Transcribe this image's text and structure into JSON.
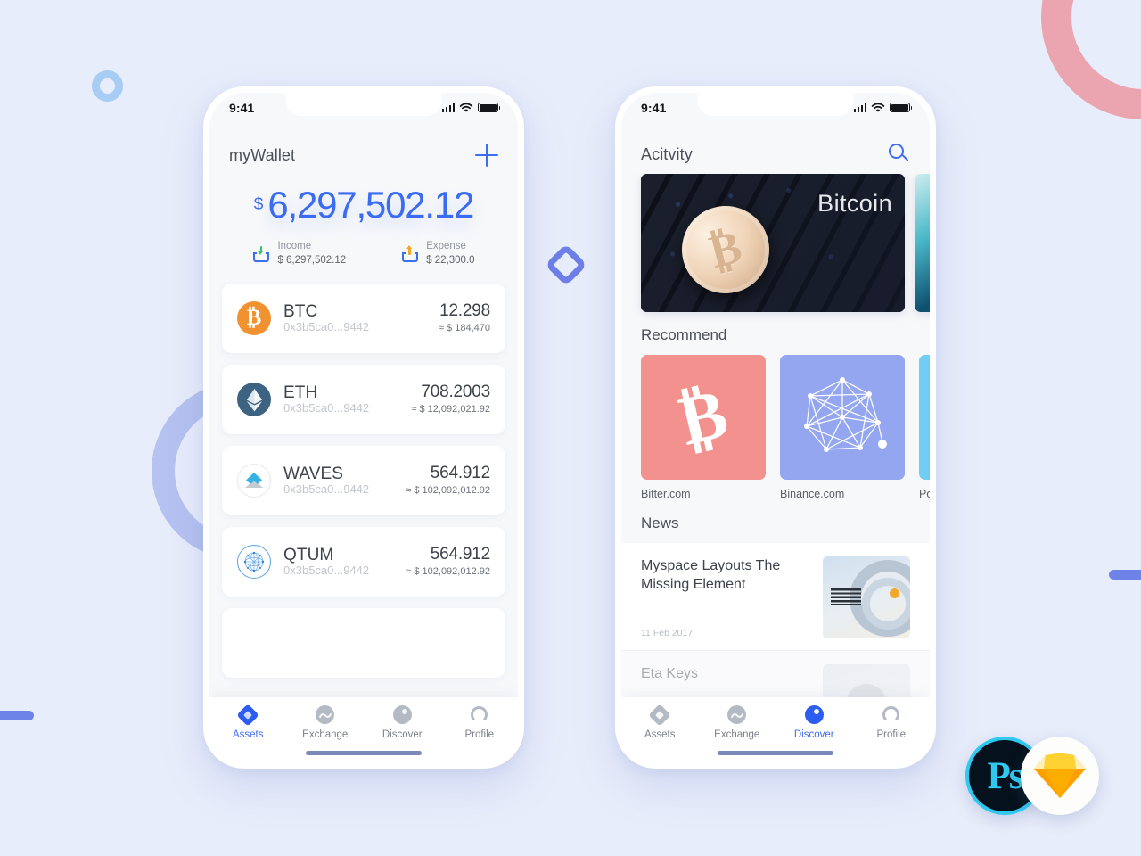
{
  "background": {
    "color": "#e8edfb",
    "decorations": [
      {
        "name": "pink-ring",
        "color": "#eaa5b0"
      },
      {
        "name": "periwinkle-ring",
        "color": "#b6c2f0"
      },
      {
        "name": "skyblue-ring",
        "color": "#a8cdf5"
      },
      {
        "name": "blue-bar-left",
        "color": "#6e83e8"
      },
      {
        "name": "blue-bar-right",
        "color": "#6e83e8"
      },
      {
        "name": "blue-diamond",
        "color": "#6e7fe8"
      }
    ]
  },
  "status_bar": {
    "time": "9:41",
    "signal_icon": "cellular-signal-icon",
    "wifi_icon": "wifi-icon",
    "battery_icon": "battery-icon"
  },
  "wallet_screen": {
    "header": {
      "title": "myWallet",
      "add_icon": "plus-icon"
    },
    "balance": {
      "currency_symbol": "$",
      "amount": "6,297,502.12",
      "color": "#3a6bf0"
    },
    "income": {
      "label": "Income",
      "value": "$ 6,297,502.12",
      "icon": "tray-download-icon",
      "arrow_color": "#3ec46d"
    },
    "expense": {
      "label": "Expense",
      "value": "$ 22,300.0",
      "icon": "tray-upload-icon",
      "arrow_color": "#f5a623"
    },
    "assets": [
      {
        "symbol": "BTC",
        "address": "0x3b5ca0...9442",
        "amount": "12.298",
        "fiat": "≈ $ 184,470",
        "icon": "bitcoin-icon",
        "icon_color": "#f0922f"
      },
      {
        "symbol": "ETH",
        "address": "0x3b5ca0...9442",
        "amount": "708.2003",
        "fiat": "≈ $ 12,092,021.92",
        "icon": "ethereum-icon",
        "icon_color": "#3c6382"
      },
      {
        "symbol": "WAVES",
        "address": "0x3b5ca0...9442",
        "amount": "564.912",
        "fiat": "≈ $ 102,092,012.92",
        "icon": "waves-icon",
        "icon_color": "#34b3e4"
      },
      {
        "symbol": "QTUM",
        "address": "0x3b5ca0...9442",
        "amount": "564.912",
        "fiat": "≈ $ 102,092,012.92",
        "icon": "qtum-icon",
        "icon_color": "#5ba4e5"
      }
    ],
    "tabs": [
      {
        "label": "Assets",
        "icon": "assets-icon",
        "active": true
      },
      {
        "label": "Exchange",
        "icon": "exchange-icon",
        "active": false
      },
      {
        "label": "Discover",
        "icon": "discover-icon",
        "active": false
      },
      {
        "label": "Profile",
        "icon": "profile-icon",
        "active": false
      }
    ]
  },
  "discover_screen": {
    "header": {
      "title": "Acitvity",
      "search_icon": "search-icon"
    },
    "banners": [
      {
        "caption": "Bitcoin",
        "image": "bitcoin-coin-on-keyboard-photo"
      },
      {
        "caption": "",
        "image": "teal-abstract-photo"
      }
    ],
    "recommend": {
      "title": "Recommend",
      "items": [
        {
          "label": "Bitter.com",
          "icon": "bitcoin-b-icon",
          "color": "#f2918d"
        },
        {
          "label": "Binance.com",
          "icon": "network-graph-icon",
          "color": "#93a6ef"
        },
        {
          "label": "Poloniex",
          "icon": "poloniex-icon",
          "color": "#72cdf5"
        }
      ]
    },
    "news": {
      "title": "News",
      "items": [
        {
          "title": "Myspace Layouts The Missing Element",
          "date": "11 Feb 2017",
          "thumb": "ibm-servers-photo"
        },
        {
          "title": "Eta Keys",
          "date": "",
          "thumb": "portrait-photo"
        }
      ]
    },
    "tabs": [
      {
        "label": "Assets",
        "icon": "assets-icon",
        "active": false
      },
      {
        "label": "Exchange",
        "icon": "exchange-icon",
        "active": false
      },
      {
        "label": "Discover",
        "icon": "discover-icon",
        "active": true
      },
      {
        "label": "Profile",
        "icon": "profile-icon",
        "active": false
      }
    ]
  },
  "badges": [
    {
      "name": "photoshop-badge",
      "label": "Ps",
      "color": "#2fc8ef"
    },
    {
      "name": "sketch-badge",
      "label": "",
      "color": "#f7a623"
    }
  ]
}
